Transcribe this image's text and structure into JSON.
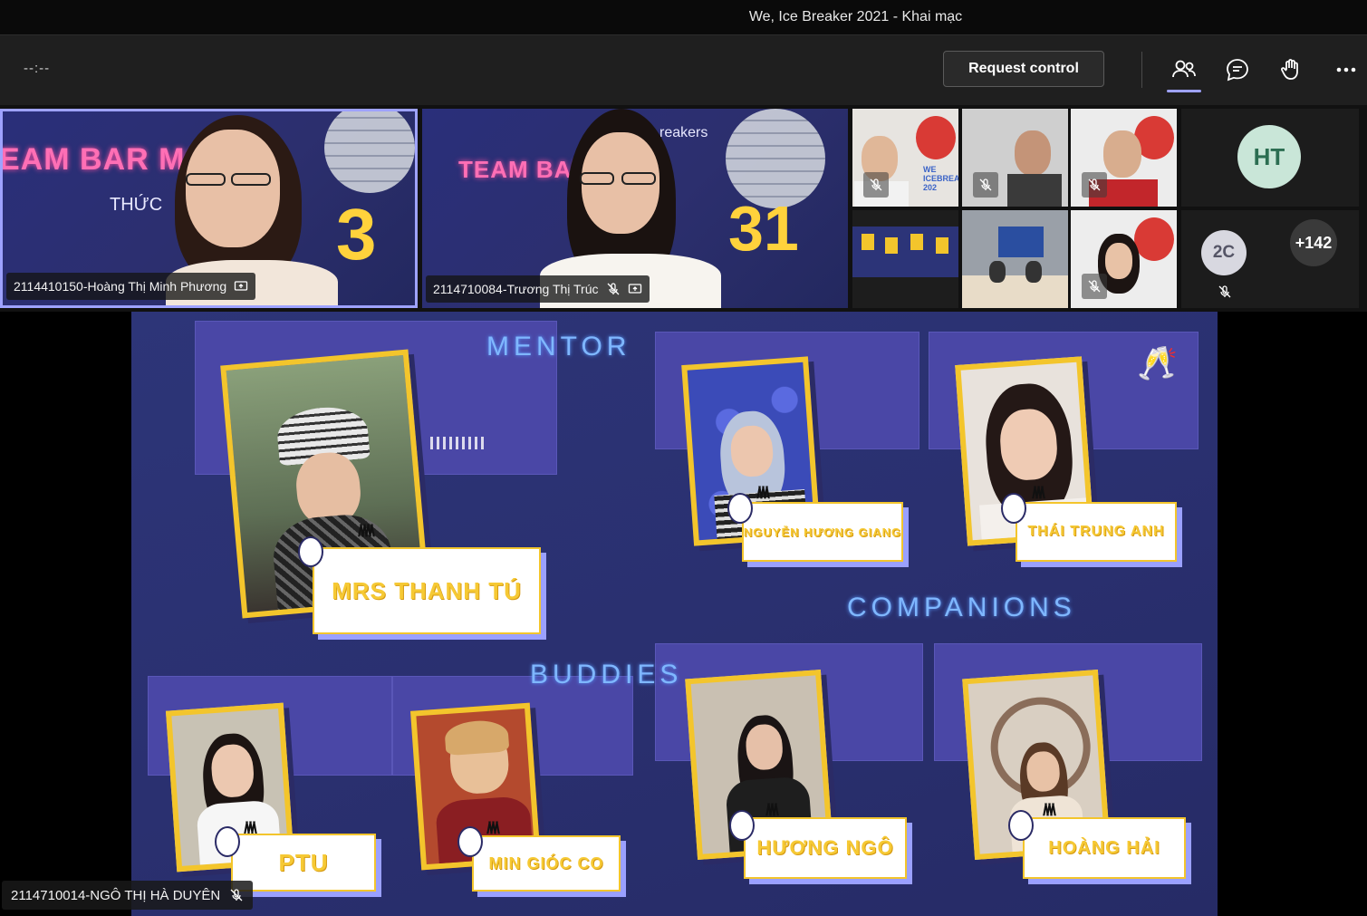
{
  "window": {
    "title": "We, Ice Breaker 2021 - Khai mạc"
  },
  "header": {
    "timer": "--:--",
    "request_control_label": "Request control",
    "icons": [
      "people-icon",
      "chat-icon",
      "raise-hand-icon",
      "more-options-icon"
    ]
  },
  "participants": {
    "large": [
      {
        "name": "2114410150-Hoàng Thị Minh Phương",
        "neon_text": "EAM BAR MO",
        "subtext": "THỨC",
        "number": "3"
      },
      {
        "name": "2114710084-Trương Thị Trúc",
        "neon_text": "TEAM BAR",
        "subtext": "reakers",
        "number": "31"
      }
    ],
    "avatars": [
      {
        "initials": "HT",
        "color": "#c9e6d8",
        "text_color": "#2c6e52"
      },
      {
        "initials": "2C",
        "color": "#d8d8e0",
        "text_color": "#555566"
      },
      {
        "initials": "+142",
        "color": "#3a3a3a",
        "text_color": "#ffffff"
      }
    ],
    "thumb_text": "WE ICEBREA 202"
  },
  "slide": {
    "headings": {
      "mentor": "MENTOR",
      "companions": "COMPANIONS",
      "buddies": "BUDDIES"
    },
    "names": {
      "mentor": "MRS THANH TÚ",
      "companion1": "NGUYỄN HƯƠNG GIANG",
      "companion2": "THÁI TRUNG ANH",
      "buddy1": "PTU",
      "buddy2": "MIN GIÓC CO",
      "companion3": "HƯƠNG NGÔ",
      "companion4": "HOÀNG HẢI"
    }
  },
  "presenter": {
    "name": "2114710014-NGÔ THỊ HÀ DUYÊN"
  },
  "colors": {
    "accent": "#9ea2ff",
    "slide_bg": "#2a3070",
    "label_yellow": "#f6c934"
  }
}
